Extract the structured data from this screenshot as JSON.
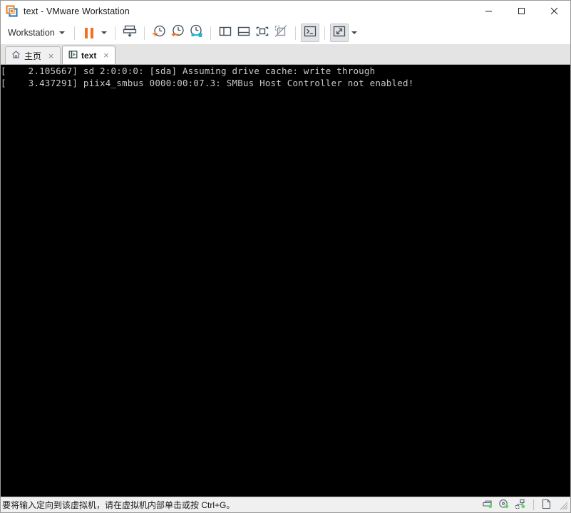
{
  "window": {
    "title": "text - VMware Workstation",
    "logo_icon": "vmware-logo-icon",
    "minimize_label": "minimize-icon",
    "maximize_label": "maximize-icon",
    "close_label": "close-icon",
    "colors": {
      "orange": "#f4701e",
      "blue": "#2a7fc9",
      "slate": "#3f4b57",
      "green": "#3faa35",
      "cyan": "#1fb6d0"
    }
  },
  "toolbar": {
    "menu_label": "Workstation",
    "menu_caret": "chevron-down-icon",
    "buttons": [
      {
        "name": "suspend-button",
        "icon": "pause-icon",
        "label": "Suspend"
      },
      {
        "name": "power-dropdown",
        "icon": "chevron-down-icon",
        "label": "Power options"
      },
      {
        "name": "send-ctrl-alt-del-button",
        "icon": "send-key-icon",
        "label": "Send Ctrl+Alt+Del"
      },
      {
        "name": "take-snapshot-button",
        "icon": "snapshot-add-icon",
        "label": "Take snapshot"
      },
      {
        "name": "revert-snapshot-button",
        "icon": "snapshot-revert-icon",
        "label": "Revert to snapshot"
      },
      {
        "name": "snapshot-manager-button",
        "icon": "snapshot-manager-icon",
        "label": "Manage snapshots"
      },
      {
        "name": "show-library-button",
        "icon": "panel-left-icon",
        "label": "Show library"
      },
      {
        "name": "show-thumbnails-button",
        "icon": "panel-bottom-icon",
        "label": "Show thumbnail bar"
      },
      {
        "name": "fit-guest-button",
        "icon": "fit-guest-icon",
        "label": "Fit guest now"
      },
      {
        "name": "autofit-disabled-button",
        "icon": "autofit-off-icon",
        "label": "Autofit disabled"
      },
      {
        "name": "console-view-button",
        "icon": "console-icon",
        "label": "Console view"
      },
      {
        "name": "fullscreen-button",
        "icon": "fullscreen-icon",
        "label": "Enter full screen"
      },
      {
        "name": "fullscreen-dropdown",
        "icon": "chevron-down-icon",
        "label": "Full screen options"
      }
    ]
  },
  "tabs": [
    {
      "name": "tab-home",
      "label": "主页",
      "icon": "home-icon",
      "close_icon": "×",
      "active": false
    },
    {
      "name": "tab-text",
      "label": "text",
      "icon": "vm-play-icon",
      "close_icon": "×",
      "active": true
    }
  ],
  "console": {
    "lines": [
      "[    2.105667] sd 2:0:0:0: [sda] Assuming drive cache: write through",
      "[    3.437291] piix4_smbus 0000:00:07.3: SMBus Host Controller not enabled!"
    ],
    "background": "#000000",
    "foreground": "#c8c8c8"
  },
  "statusbar": {
    "message": "要将输入定向到该虚拟机，请在虚拟机内部单击或按 Ctrl+G。",
    "devices": [
      {
        "name": "status-hard-disk-icon",
        "icon": "hard-disk-icon"
      },
      {
        "name": "status-cd-dvd-icon",
        "icon": "cd-dvd-icon"
      },
      {
        "name": "status-network-icon",
        "icon": "network-icon"
      },
      {
        "name": "status-document-icon",
        "icon": "document-icon"
      }
    ],
    "grip_icon": "resize-grip-icon"
  }
}
